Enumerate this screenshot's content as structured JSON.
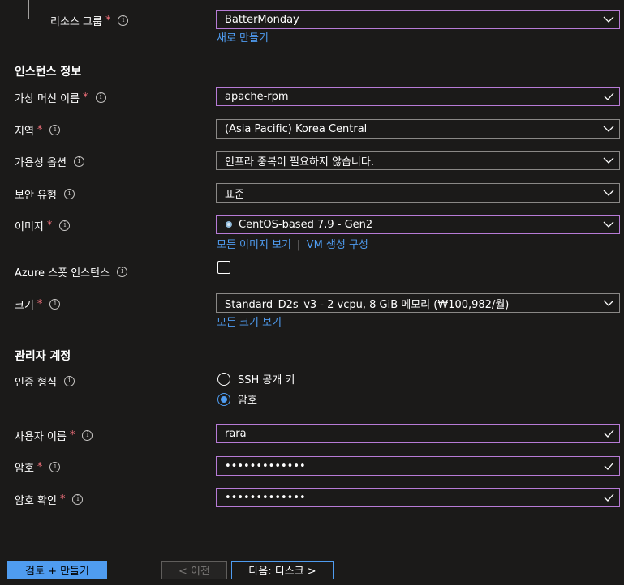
{
  "colors": {
    "background": "#1b1a19",
    "accent": "#4f9cf0",
    "required": "#f1707b",
    "focus_border": "#b77bd6",
    "field_border": "#8a8886"
  },
  "resource_group": {
    "label": "리소스 그룹",
    "required": "*",
    "value": "BatterMonday",
    "create_new_link": "새로 만들기"
  },
  "instance_section": {
    "title": "인스턴스 정보",
    "vm_name": {
      "label": "가상 머신 이름",
      "required": "*",
      "value": "apache-rpm"
    },
    "region": {
      "label": "지역",
      "required": "*",
      "value": "(Asia Pacific) Korea Central"
    },
    "availability": {
      "label": "가용성 옵션",
      "value": "인프라 중복이 필요하지 않습니다."
    },
    "security_type": {
      "label": "보안 유형",
      "value": "표준"
    },
    "image": {
      "label": "이미지",
      "required": "*",
      "value": "CentOS-based 7.9 - Gen2",
      "icon": "centos-icon",
      "link_all_images": "모든 이미지 보기",
      "link_separator": "|",
      "link_configure_vm": "VM 생성 구성"
    },
    "spot": {
      "label": "Azure 스폿 인스턴스",
      "checked": false
    },
    "size": {
      "label": "크기",
      "required": "*",
      "value": "Standard_D2s_v3 - 2 vcpu, 8 GiB 메모리 (₩100,982/월)",
      "link_all_sizes": "모든 크기 보기"
    }
  },
  "admin_section": {
    "title": "관리자 계정",
    "auth_type": {
      "label": "인증 형식",
      "options": [
        "SSH 공개 키",
        "암호"
      ],
      "selected": "암호"
    },
    "username": {
      "label": "사용자 이름",
      "required": "*",
      "value": "rara"
    },
    "password": {
      "label": "암호",
      "required": "*",
      "value": "•••••••••••••"
    },
    "password_confirm": {
      "label": "암호 확인",
      "required": "*",
      "value": "•••••••••••••"
    }
  },
  "footer": {
    "review_create": "검토 + 만들기",
    "previous": "< 이전",
    "next": "다음: 디스크 >"
  },
  "icons": {
    "info": "i"
  }
}
